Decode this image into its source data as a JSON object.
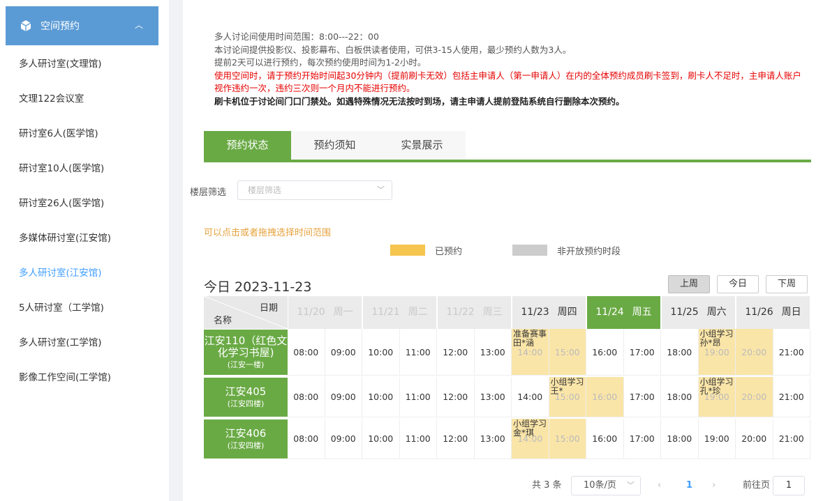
{
  "sidebar": {
    "header_label": "空间预约",
    "items": [
      "多人研讨室(文理馆)",
      "文理122会议室",
      "研讨室6人(医学馆)",
      "研讨室10人(医学馆)",
      "研讨室26人(医学馆)",
      "多媒体研讨室(江安馆)",
      "多人研讨室(江安馆)",
      "5人研讨室（工学馆)",
      "多人研讨室(工学馆)",
      "影像工作空间(工学馆)"
    ],
    "active_index": 6
  },
  "notice": {
    "line1": "多人讨论间使用时间范围：8:00---22：00",
    "line2": "本讨论间提供投影仪、投影幕布、白板供读者使用，可供3-15人使用，最少预约人数为3人。",
    "line3": "提前2天可以进行预约，每次预约使用时间为1-2小时。",
    "line4": "使用空间时，请于预约开始时间起30分钟内（提前刷卡无效）包括主申请人（第一申请人）在内的全体预约成员刷卡签到，刷卡人不足时，主申请人账户视作违约一次，违约三次则一个月内不能进行预约。",
    "line5": "刷卡机位于讨论间门口门禁处。如遇特殊情况无法按时到场，请主申请人提前登陆系统自行删除本次预约。"
  },
  "tabs": [
    "预约状态",
    "预约须知",
    "实景展示"
  ],
  "filter": {
    "label": "楼层筛选",
    "placeholder": "楼层筛选"
  },
  "hint": "可以点击或者拖拽选择时间范围",
  "legend": {
    "booked": "已预约",
    "closed": "非开放预约时段"
  },
  "colors": {
    "booked": "#f5c54f",
    "closed": "#cccccc",
    "green": "#6aaa45",
    "active_blue": "#409eff"
  },
  "today": "今日 2023-11-23",
  "week_buttons": [
    "上周",
    "今日",
    "下周"
  ],
  "grid_header": {
    "date_label": "日期",
    "name_label": "名称"
  },
  "days": [
    {
      "date": "11/20",
      "week": "周一",
      "state": "past"
    },
    {
      "date": "11/21",
      "week": "周二",
      "state": "past"
    },
    {
      "date": "11/22",
      "week": "周三",
      "state": "past"
    },
    {
      "date": "11/23",
      "week": "周四",
      "state": "normal"
    },
    {
      "date": "11/24",
      "week": "周五",
      "state": "selected"
    },
    {
      "date": "11/25",
      "week": "周六",
      "state": "normal"
    },
    {
      "date": "11/26",
      "week": "周日",
      "state": "normal"
    }
  ],
  "times": [
    "08:00",
    "09:00",
    "10:00",
    "11:00",
    "12:00",
    "13:00",
    "14:00",
    "15:00",
    "16:00",
    "17:00",
    "18:00",
    "19:00",
    "20:00",
    "21:00"
  ],
  "rooms": [
    {
      "name": "江安110（红色文化学习书屋)",
      "sub": "(江安一楼)",
      "booked": [
        6,
        7,
        11,
        12
      ],
      "labels": [
        {
          "slot": 6,
          "text": "准备赛事田*涵"
        },
        {
          "slot": 11,
          "text": "小组学习孙*昂"
        }
      ]
    },
    {
      "name": "江安405",
      "sub": "(江安四楼)",
      "booked": [
        7,
        8,
        11,
        12
      ],
      "labels": [
        {
          "slot": 7,
          "text": "小组学习王*"
        },
        {
          "slot": 11,
          "text": "小组学习孔*珍"
        }
      ]
    },
    {
      "name": "江安406",
      "sub": "(江安四楼)",
      "booked": [
        6,
        7
      ],
      "labels": [
        {
          "slot": 6,
          "text": "小组学习金*琪"
        }
      ]
    }
  ],
  "pagination": {
    "total": "共 3 条",
    "page_size": "10条/页",
    "current": "1",
    "goto_label": "前往页",
    "goto_value": "1"
  }
}
